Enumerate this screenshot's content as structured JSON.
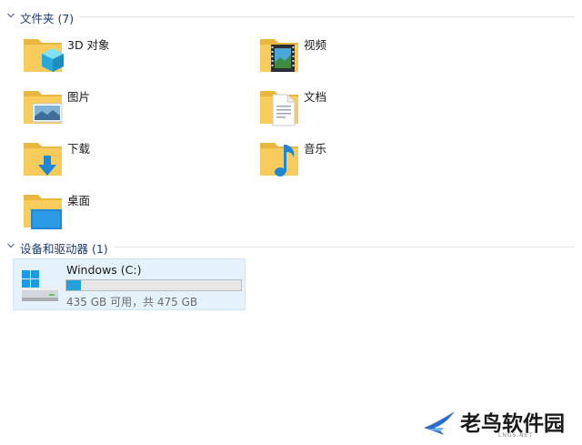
{
  "groups": {
    "folders": {
      "title": "文件夹 (7)"
    },
    "drives": {
      "title": "设备和驱动器 (1)"
    }
  },
  "folders": [
    {
      "label": "3D 对象",
      "icon": "3d-objects-icon"
    },
    {
      "label": "视频",
      "icon": "videos-icon"
    },
    {
      "label": "图片",
      "icon": "pictures-icon"
    },
    {
      "label": "文档",
      "icon": "documents-icon"
    },
    {
      "label": "下载",
      "icon": "downloads-icon"
    },
    {
      "label": "音乐",
      "icon": "music-icon"
    },
    {
      "label": "桌面",
      "icon": "desktop-icon"
    }
  ],
  "drives": [
    {
      "name": "Windows (C:)",
      "free_text": "435 GB 可用，共 475 GB",
      "used_fraction": 0.084,
      "icon": "hard-drive-icon"
    }
  ],
  "watermark": {
    "brand": "老鸟软件园",
    "sub": "LNGS.NET"
  },
  "colors": {
    "folder": "#f7cc5c",
    "accent": "#26a0da",
    "selection_bg": "#e5f1fb",
    "group_title": "#1e3a6e"
  }
}
